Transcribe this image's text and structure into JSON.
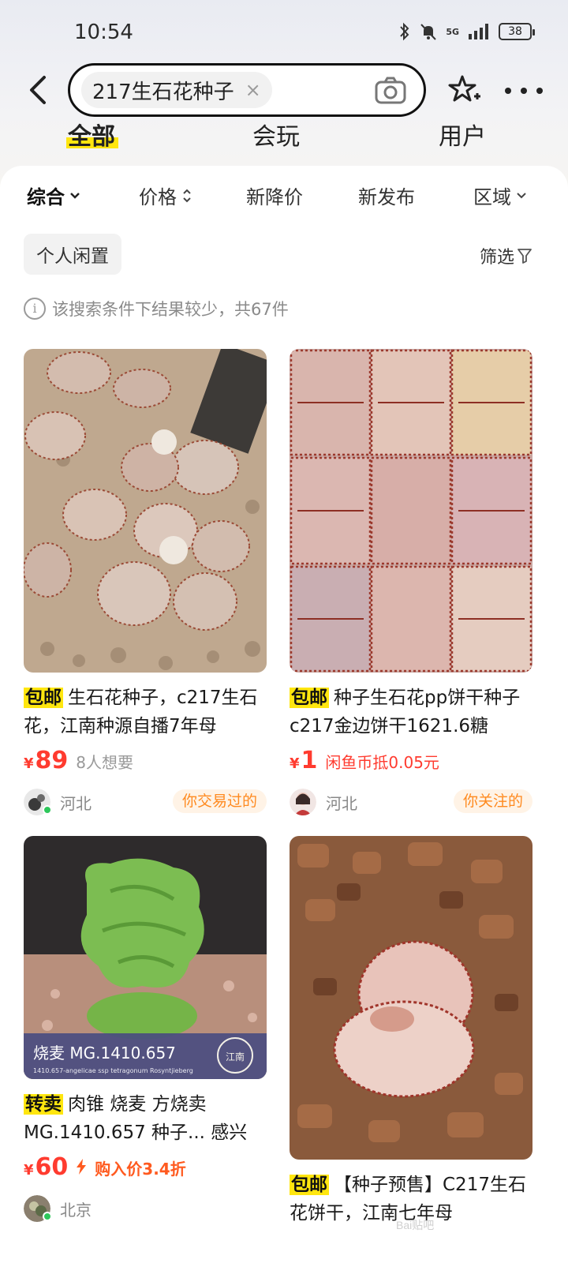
{
  "status_bar": {
    "time": "10:54",
    "network": "5G",
    "battery": "38"
  },
  "search": {
    "query": "217生石花种子",
    "clear_symbol": "×"
  },
  "tabs": [
    {
      "label": "全部",
      "active": true
    },
    {
      "label": "会玩",
      "active": false
    },
    {
      "label": "用户",
      "active": false
    }
  ],
  "sort": [
    {
      "label": "综合",
      "active": true,
      "icon": "chevron-down-icon"
    },
    {
      "label": "价格",
      "active": false,
      "icon": "sort-updown-icon"
    },
    {
      "label": "新降价",
      "active": false
    },
    {
      "label": "新发布",
      "active": false
    },
    {
      "label": "区域",
      "active": false,
      "icon": "chevron-down-icon"
    }
  ],
  "personal_filter": "个人闲置",
  "filter_label": "筛选",
  "notice": "该搜索条件下结果较少，共67件",
  "products": [
    {
      "badge": "包邮",
      "title": "生石花种子，c217生石花，江南种源自播7年母",
      "price": "89",
      "currency": "¥",
      "want": "8人想要",
      "location": "河北",
      "seller_tag": "你交易过的"
    },
    {
      "badge": "包邮",
      "title": "种子生石花pp饼干种子c217金边饼干1621.6糖",
      "price": "1",
      "currency": "¥",
      "coin_note": "闲鱼币抵0.05元",
      "location": "河北",
      "seller_tag": "你关注的"
    },
    {
      "badge": "转卖",
      "title": "肉锥 烧麦 方烧卖 MG.1410.657 种子... 感兴",
      "price": "60",
      "currency": "¥",
      "discount": "购入价3.4折",
      "location": "北京",
      "image_caption": "烧麦 MG.1410.657",
      "image_subcaption": "1410.657-angelicae ssp tetragonum Rosyntjieberg",
      "image_seal": "江南"
    },
    {
      "badge": "包邮",
      "title": "【种子预售】C217生石花饼干，江南七年母",
      "price": "",
      "currency": "¥"
    }
  ],
  "watermark": "Bai贴吧"
}
